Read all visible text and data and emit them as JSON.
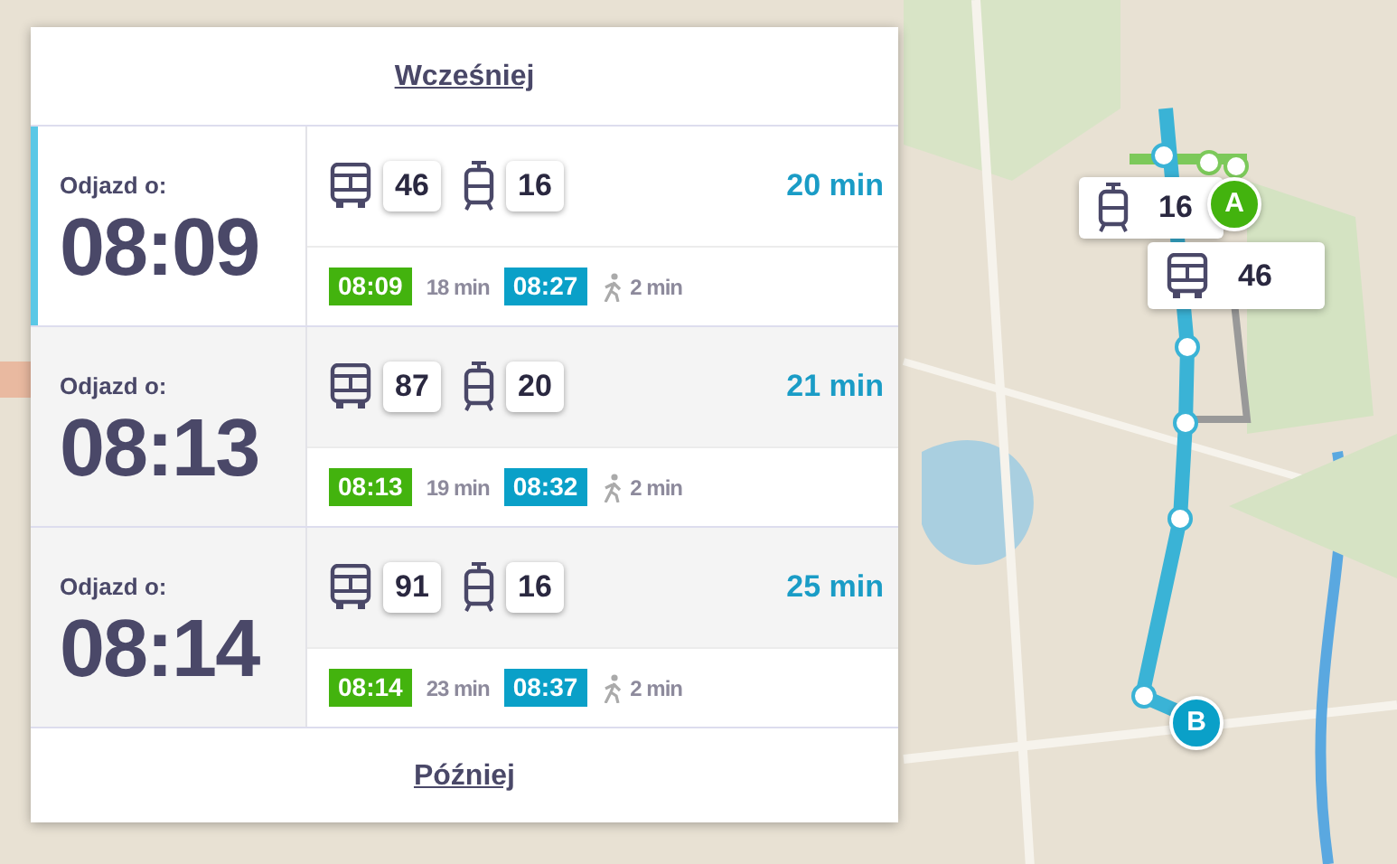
{
  "earlier_link": "Wcześniej",
  "connections": [
    {
      "selected": true,
      "departure_label": "Odjazd o:",
      "departure_time": "08:09",
      "legs": [
        {
          "kind": "bus",
          "line": "46"
        },
        {
          "kind": "tram",
          "line": "16"
        }
      ],
      "duration": "20 min",
      "segments": [
        {
          "kind": "departure",
          "text": "08:09"
        },
        {
          "kind": "ride",
          "text": "18 min"
        },
        {
          "kind": "arrival",
          "text": "08:27"
        },
        {
          "kind": "walk",
          "text": "2 min"
        }
      ]
    },
    {
      "selected": false,
      "departure_label": "Odjazd o:",
      "departure_time": "08:13",
      "legs": [
        {
          "kind": "bus",
          "line": "87"
        },
        {
          "kind": "tram",
          "line": "20"
        }
      ],
      "duration": "21 min",
      "segments": [
        {
          "kind": "departure",
          "text": "08:13"
        },
        {
          "kind": "ride",
          "text": "19 min"
        },
        {
          "kind": "arrival",
          "text": "08:32"
        },
        {
          "kind": "walk",
          "text": "2 min"
        }
      ]
    },
    {
      "selected": false,
      "departure_label": "Odjazd o:",
      "departure_time": "08:14",
      "legs": [
        {
          "kind": "bus",
          "line": "91"
        },
        {
          "kind": "tram",
          "line": "16"
        }
      ],
      "duration": "25 min",
      "segments": [
        {
          "kind": "departure",
          "text": "08:14"
        },
        {
          "kind": "ride",
          "text": "23 min"
        },
        {
          "kind": "arrival",
          "text": "08:37"
        },
        {
          "kind": "walk",
          "text": "2 min"
        }
      ]
    }
  ],
  "later_link": "Później",
  "map": {
    "popups": [
      {
        "kind": "tram",
        "line": "16"
      },
      {
        "kind": "bus",
        "line": "46"
      }
    ],
    "markers": [
      {
        "kind": "start",
        "label": "A"
      },
      {
        "kind": "end",
        "label": "B"
      }
    ]
  }
}
